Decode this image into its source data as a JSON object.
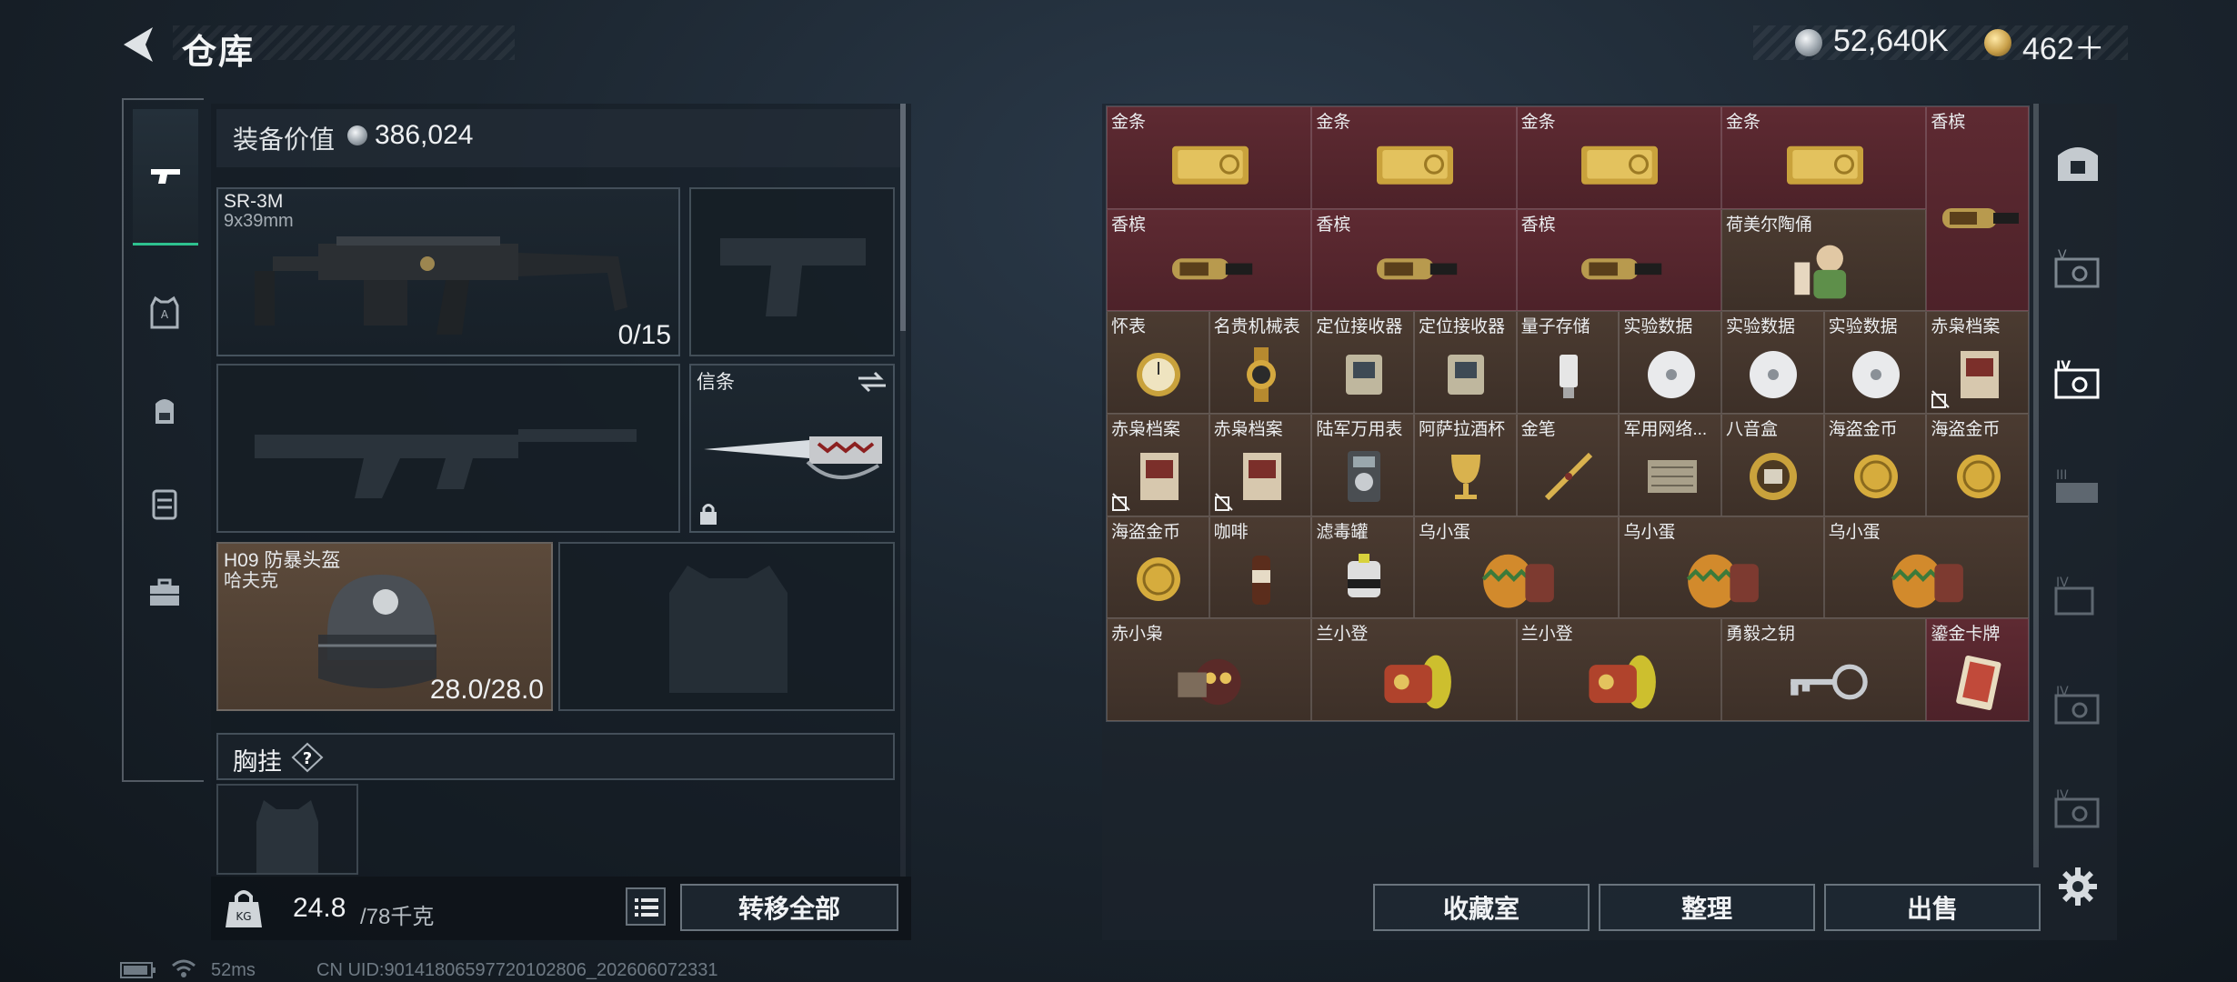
{
  "header": {
    "title": "仓库",
    "silver_currency": "52,640K",
    "gold_currency": "462＋"
  },
  "equipment": {
    "value_label": "装备价值",
    "value": "386,024",
    "primary_weapon": {
      "name": "SR-3M",
      "caliber": "9x39mm",
      "ammo": "0/15"
    },
    "melee": {
      "name": "信条"
    },
    "helmet": {
      "name": "H09 防暴头盔",
      "sub": "哈夫克",
      "durability": "28.0/28.0"
    },
    "chest_rig_label": "胸挂",
    "help_glyph": "?",
    "weight": "24.8",
    "weight_max": "/78千克",
    "transfer_all_label": "转移全部"
  },
  "storage": {
    "rows": [
      [
        {
          "label": "金条",
          "icon": "gold-bar-icon",
          "span": 2,
          "color": "red"
        },
        {
          "label": "金条",
          "icon": "gold-bar-icon",
          "span": 2,
          "color": "red"
        },
        {
          "label": "金条",
          "icon": "gold-bar-icon",
          "span": 2,
          "color": "red"
        },
        {
          "label": "金条",
          "icon": "gold-bar-icon",
          "span": 2,
          "color": "red"
        },
        {
          "label": "香槟",
          "icon": "champagne-icon",
          "span": 1,
          "rowspan": 2,
          "color": "red"
        }
      ],
      [
        {
          "label": "香槟",
          "icon": "champagne-icon",
          "span": 2,
          "color": "red"
        },
        {
          "label": "香槟",
          "icon": "champagne-icon",
          "span": 2,
          "color": "red"
        },
        {
          "label": "香槟",
          "icon": "champagne-icon",
          "span": 2,
          "color": "red"
        },
        {
          "label": "荷美尔陶俑",
          "icon": "figurine-icon",
          "span": 2,
          "color": "brown"
        }
      ],
      [
        {
          "label": "怀表",
          "icon": "pocket-watch-icon",
          "span": 1,
          "color": "brown"
        },
        {
          "label": "名贵机械表",
          "icon": "wristwatch-icon",
          "span": 1,
          "color": "brown"
        },
        {
          "label": "定位接收器",
          "icon": "receiver-icon",
          "span": 1,
          "color": "brown"
        },
        {
          "label": "定位接收器",
          "icon": "receiver-icon",
          "span": 1,
          "color": "brown"
        },
        {
          "label": "量子存储",
          "icon": "usb-drive-icon",
          "span": 1,
          "color": "brown"
        },
        {
          "label": "实验数据",
          "icon": "disc-icon",
          "span": 1,
          "color": "brown"
        },
        {
          "label": "实验数据",
          "icon": "disc-icon",
          "span": 1,
          "color": "brown"
        },
        {
          "label": "实验数据",
          "icon": "disc-icon",
          "span": 1,
          "color": "brown"
        },
        {
          "label": "赤枭档案",
          "icon": "dossier-icon",
          "span": 1,
          "color": "brown",
          "badge": true
        }
      ],
      [
        {
          "label": "赤枭档案",
          "icon": "dossier-icon",
          "span": 1,
          "color": "brown",
          "badge": true
        },
        {
          "label": "赤枭档案",
          "icon": "dossier-icon",
          "span": 1,
          "color": "brown",
          "badge": true
        },
        {
          "label": "陆军万用表",
          "icon": "multimeter-icon",
          "span": 1,
          "color": "brown"
        },
        {
          "label": "阿萨拉酒杯",
          "icon": "goblet-icon",
          "span": 1,
          "color": "brown"
        },
        {
          "label": "金笔",
          "icon": "gold-pen-icon",
          "span": 1,
          "color": "brown"
        },
        {
          "label": "军用网络...",
          "icon": "network-module-icon",
          "span": 1,
          "color": "brown"
        },
        {
          "label": "八音盒",
          "icon": "music-box-icon",
          "span": 1,
          "color": "brown"
        },
        {
          "label": "海盗金币",
          "icon": "pirate-coin-icon",
          "span": 1,
          "color": "brown"
        },
        {
          "label": "海盗金币",
          "icon": "pirate-coin-icon",
          "span": 1,
          "color": "brown"
        }
      ],
      [
        {
          "label": "海盗金币",
          "icon": "pirate-coin-icon",
          "span": 1,
          "color": "brown"
        },
        {
          "label": "咖啡",
          "icon": "coffee-icon",
          "span": 1,
          "color": "brown"
        },
        {
          "label": "滤毒罐",
          "icon": "filter-canister-icon",
          "span": 1,
          "color": "brown"
        },
        {
          "label": "乌小蛋",
          "icon": "egg-toy-icon",
          "span": 2,
          "color": "brown"
        },
        {
          "label": "乌小蛋",
          "icon": "egg-toy-icon",
          "span": 2,
          "color": "brown"
        },
        {
          "label": "乌小蛋",
          "icon": "egg-toy-icon",
          "span": 2,
          "color": "brown"
        }
      ],
      [
        {
          "label": "赤小枭",
          "icon": "owl-toy-icon",
          "span": 2,
          "color": "brown"
        },
        {
          "label": "兰小登",
          "icon": "lantern-toy-icon",
          "span": 2,
          "color": "brown"
        },
        {
          "label": "兰小登",
          "icon": "lantern-toy-icon",
          "span": 2,
          "color": "brown"
        },
        {
          "label": "勇毅之钥",
          "icon": "key-icon",
          "span": 2,
          "color": "brown"
        },
        {
          "label": "鎏金卡牌",
          "icon": "gilded-card-icon",
          "span": 1,
          "color": "red"
        }
      ]
    ],
    "buttons": {
      "collect": "收藏室",
      "sort": "整理",
      "sell": "出售"
    }
  },
  "status": {
    "ping": "52ms",
    "uid": "CN UID:9014180659772010280​6_202606072331"
  },
  "colors": {
    "accent_green": "#2ec18f",
    "rarity_red": "#5e2a32",
    "rarity_brown": "#4b3b31"
  }
}
